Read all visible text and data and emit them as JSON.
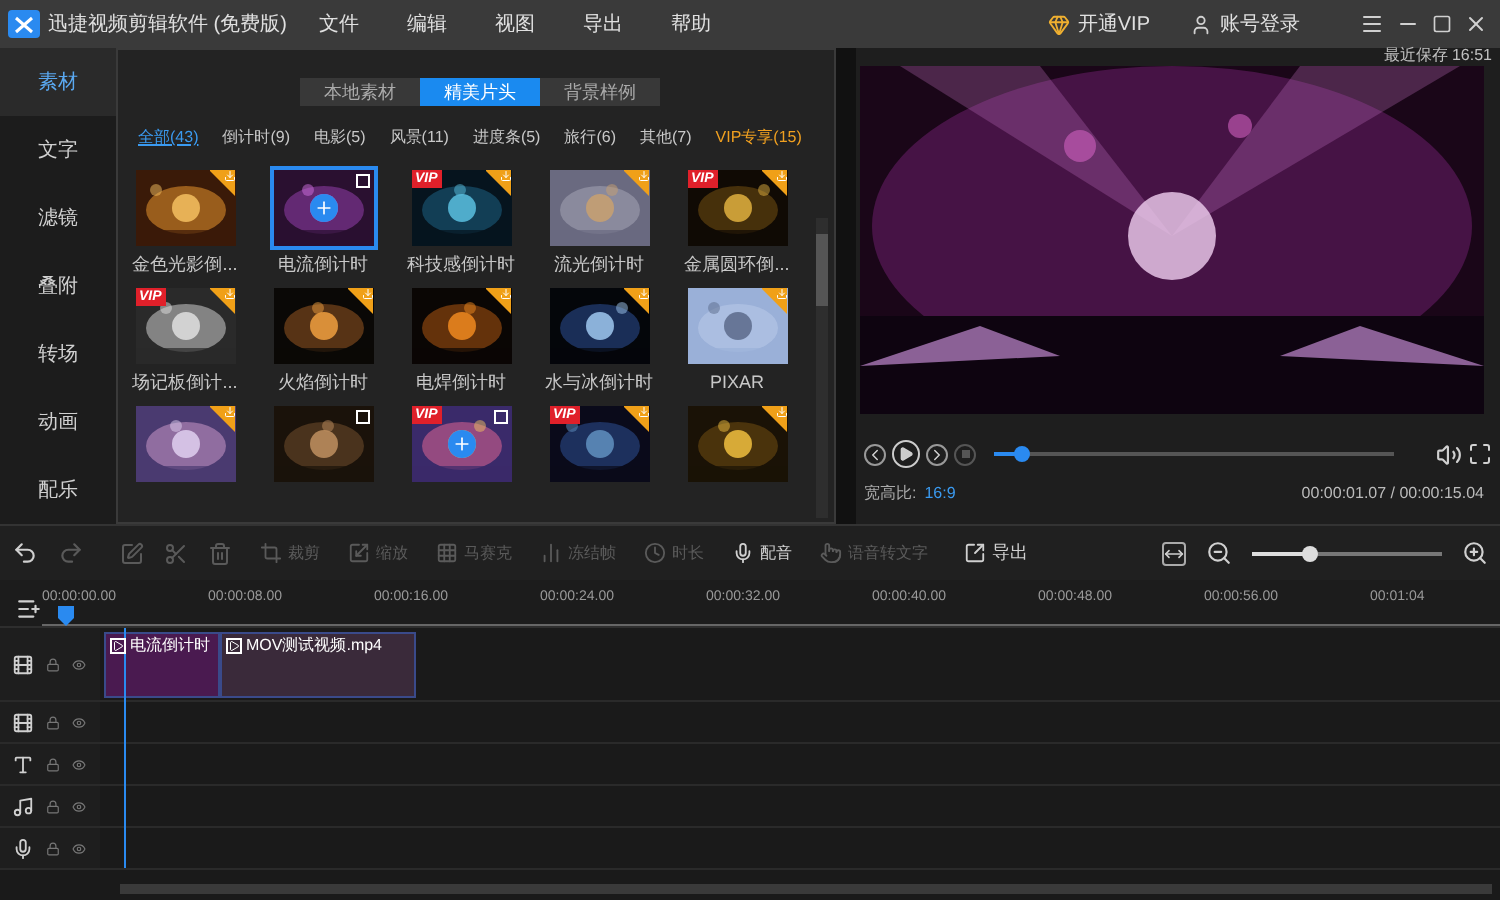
{
  "window": {
    "title": "迅捷视频剪辑软件 (免费版)",
    "menu": [
      "文件",
      "编辑",
      "视图",
      "导出",
      "帮助"
    ],
    "vip_link": "开通VIP",
    "login_link": "账号登录"
  },
  "sidebar": {
    "items": [
      {
        "label": "素材",
        "selected": true
      },
      {
        "label": "文字",
        "selected": false
      },
      {
        "label": "滤镜",
        "selected": false
      },
      {
        "label": "叠附",
        "selected": false
      },
      {
        "label": "转场",
        "selected": false
      },
      {
        "label": "动画",
        "selected": false
      },
      {
        "label": "配乐",
        "selected": false
      }
    ]
  },
  "library": {
    "tabs": [
      {
        "label": "本地素材",
        "selected": false
      },
      {
        "label": "精美片头",
        "selected": true
      },
      {
        "label": "背景样例",
        "selected": false
      }
    ],
    "filters": [
      {
        "label": "全部(43)",
        "selected": true,
        "vip": false
      },
      {
        "label": "倒计时(9)",
        "selected": false,
        "vip": false
      },
      {
        "label": "电影(5)",
        "selected": false,
        "vip": false
      },
      {
        "label": "风景(11)",
        "selected": false,
        "vip": false
      },
      {
        "label": "进度条(5)",
        "selected": false,
        "vip": false
      },
      {
        "label": "旅行(6)",
        "selected": false,
        "vip": false
      },
      {
        "label": "其他(7)",
        "selected": false,
        "vip": false
      },
      {
        "label": "VIP专享(15)",
        "selected": false,
        "vip": true
      }
    ],
    "items": [
      {
        "name": "金色光影倒...",
        "download": true,
        "preview": false,
        "selected": false,
        "hovered": false
      },
      {
        "name": "电流倒计时",
        "download": false,
        "preview": true,
        "selected": true,
        "hovered": true
      },
      {
        "name": "科技感倒计时",
        "vip": "VIP",
        "download": true,
        "preview": false,
        "selected": false,
        "hovered": false
      },
      {
        "name": "流光倒计时",
        "download": true,
        "preview": false,
        "selected": false,
        "hovered": false
      },
      {
        "name": "金属圆环倒...",
        "vip": "VIP",
        "download": true,
        "preview": false,
        "selected": false,
        "hovered": false
      },
      {
        "name": "场记板倒计...",
        "vip": "VIP",
        "download": true,
        "preview": false,
        "selected": false,
        "hovered": false
      },
      {
        "name": "火焰倒计时",
        "download": true,
        "preview": false,
        "selected": false,
        "hovered": false
      },
      {
        "name": "电焊倒计时",
        "download": true,
        "preview": false,
        "selected": false,
        "hovered": false
      },
      {
        "name": "水与冰倒计时",
        "download": true,
        "preview": false,
        "selected": false,
        "hovered": false
      },
      {
        "name": "PIXAR",
        "download": true,
        "preview": false,
        "selected": false,
        "hovered": false
      },
      {
        "download": true,
        "preview": false,
        "selected": false,
        "hovered": false
      },
      {
        "download": false,
        "preview": true,
        "selected": false,
        "hovered": false
      },
      {
        "vip": "VIP",
        "download": false,
        "preview": true,
        "selected": false,
        "hovered": true
      },
      {
        "vip": "VIP",
        "download": true,
        "preview": false,
        "selected": false,
        "hovered": false
      },
      {
        "download": true,
        "preview": false,
        "selected": false,
        "hovered": false
      }
    ]
  },
  "preview": {
    "saved": "最近保存 16:51",
    "stop_disabled": true,
    "progress": {
      "level": 0.07
    },
    "aspect_label": "宽高比:",
    "aspect": "16:9",
    "time": "00:00:01.07 / 00:00:15.04"
  },
  "toolbar": {
    "undo_disabled": false,
    "redo_disabled": true,
    "edit_disabled": true,
    "cut_disabled": true,
    "delete_disabled": true,
    "tools": [
      {
        "label": "裁剪",
        "disabled": true
      },
      {
        "label": "缩放",
        "disabled": true
      },
      {
        "label": "马赛克",
        "disabled": true
      },
      {
        "label": "冻结帧",
        "disabled": true
      },
      {
        "label": "时长",
        "disabled": true
      },
      {
        "label": "配音",
        "disabled": false
      },
      {
        "label": "语音转文字",
        "disabled": true
      }
    ],
    "export": "导出",
    "zoom": {
      "level": 0.3
    }
  },
  "timeline": {
    "ticks": [
      "00:00:00.00",
      "00:00:08.00",
      "00:00:16.00",
      "00:00:24.00",
      "00:00:32.00",
      "00:00:40.00",
      "00:00:48.00",
      "00:00:56.00",
      "00:01:04"
    ],
    "tracks": [
      {
        "kind": "video",
        "clips": [
          {
            "name": "电流倒计时"
          },
          {
            "name": "MOV测试视频.mp4"
          }
        ]
      },
      {
        "kind": "overlay"
      },
      {
        "kind": "text"
      },
      {
        "kind": "music"
      },
      {
        "kind": "voice"
      }
    ]
  }
}
